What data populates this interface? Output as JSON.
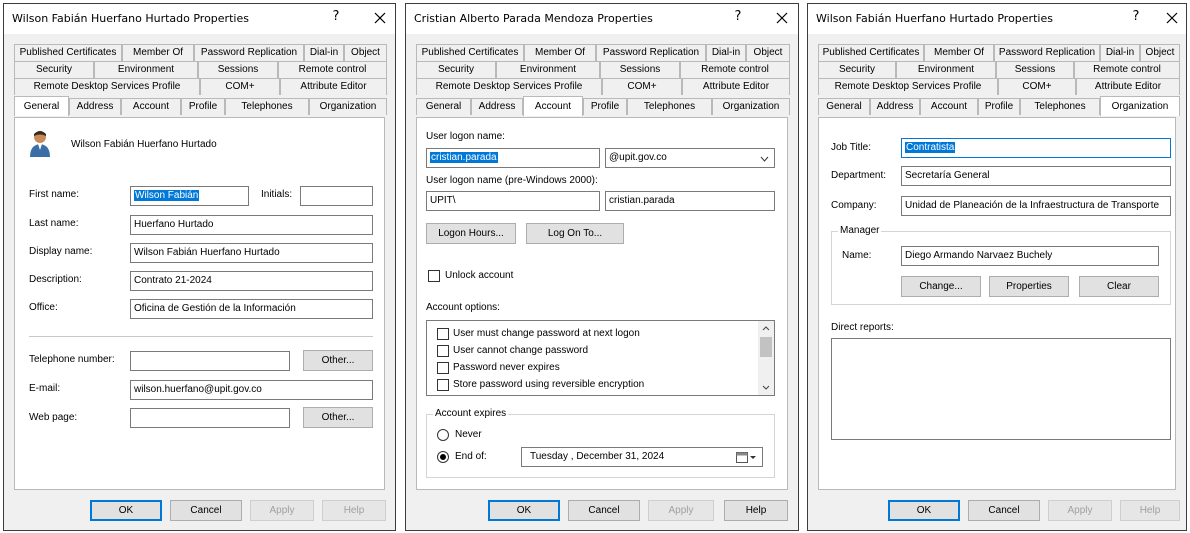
{
  "dialog1": {
    "title": "Wilson Fabián Huerfano Hurtado Properties",
    "help_glyph": "?",
    "tabs_row1": [
      "Published Certificates",
      "Member Of",
      "Password Replication",
      "Dial-in",
      "Object"
    ],
    "tabs_row2": [
      "Security",
      "Environment",
      "Sessions",
      "Remote control"
    ],
    "tabs_row3": [
      "Remote Desktop Services Profile",
      "COM+",
      "Attribute Editor"
    ],
    "tabs_row4": [
      "General",
      "Address",
      "Account",
      "Profile",
      "Telephones",
      "Organization"
    ],
    "active_tab": "General",
    "user_name": "Wilson Fabián Huerfano Hurtado",
    "first_name_label": "First name:",
    "first_name": "Wilson Fabián",
    "initials_label": "Initials:",
    "initials": "",
    "last_name_label": "Last name:",
    "last_name": "Huerfano Hurtado",
    "display_name_label": "Display name:",
    "display_name": "Wilson Fabián Huerfano Hurtado",
    "description_label": "Description:",
    "description": "Contrato 21-2024",
    "office_label": "Office:",
    "office": "Oficina de Gestión de la Información",
    "telephone_label": "Telephone number:",
    "telephone": "",
    "other_label": "Other...",
    "email_label": "E-mail:",
    "email": "wilson.huerfano@upit.gov.co",
    "webpage_label": "Web page:",
    "webpage": "",
    "ok": "OK",
    "cancel": "Cancel",
    "apply": "Apply",
    "help": "Help"
  },
  "dialog2": {
    "title": "Cristian Alberto Parada Mendoza Properties",
    "help_glyph": "?",
    "tabs_row1": [
      "Published Certificates",
      "Member Of",
      "Password Replication",
      "Dial-in",
      "Object"
    ],
    "tabs_row2": [
      "Security",
      "Environment",
      "Sessions",
      "Remote control"
    ],
    "tabs_row3": [
      "Remote Desktop Services Profile",
      "COM+",
      "Attribute Editor"
    ],
    "tabs_row4": [
      "General",
      "Address",
      "Account",
      "Profile",
      "Telephones",
      "Organization"
    ],
    "active_tab": "Account",
    "logon_label": "User logon name:",
    "logon_name": "cristian.parada",
    "domain": "@upit.gov.co",
    "pre2000_label": "User logon name (pre-Windows 2000):",
    "pre2000_domain": "UPIT\\",
    "pre2000_name": "cristian.parada",
    "logon_hours": "Logon Hours...",
    "log_on_to": "Log On To...",
    "unlock_label": "Unlock account",
    "options_label": "Account options:",
    "options": [
      "User must change password at next logon",
      "User cannot change password",
      "Password never expires",
      "Store password using reversible encryption"
    ],
    "expires_label": "Account expires",
    "never_label": "Never",
    "endof_label": "End of:",
    "end_date": "Tuesday   , December 31, 2024",
    "ok": "OK",
    "cancel": "Cancel",
    "apply": "Apply",
    "help": "Help"
  },
  "dialog3": {
    "title": "Wilson Fabián Huerfano Hurtado Properties",
    "help_glyph": "?",
    "tabs_row1": [
      "Published Certificates",
      "Member Of",
      "Password Replication",
      "Dial-in",
      "Object"
    ],
    "tabs_row2": [
      "Security",
      "Environment",
      "Sessions",
      "Remote control"
    ],
    "tabs_row3": [
      "Remote Desktop Services Profile",
      "COM+",
      "Attribute Editor"
    ],
    "tabs_row4": [
      "General",
      "Address",
      "Account",
      "Profile",
      "Telephones",
      "Organization"
    ],
    "active_tab": "Organization",
    "job_title_label": "Job Title:",
    "job_title": "Contratista",
    "department_label": "Department:",
    "department": "Secretaría General",
    "company_label": "Company:",
    "company": "Unidad de Planeación de la Infraestructura de Transporte",
    "manager_label": "Manager",
    "name_label": "Name:",
    "manager_name": "Diego Armando Narvaez Buchely",
    "change": "Change...",
    "properties": "Properties",
    "clear": "Clear",
    "direct_reports_label": "Direct reports:",
    "ok": "OK",
    "cancel": "Cancel",
    "apply": "Apply",
    "help": "Help"
  },
  "colors": {
    "selection": "#0078d7",
    "dialog_bg": "#f0f0f0",
    "panel_bg": "#ffffff"
  }
}
